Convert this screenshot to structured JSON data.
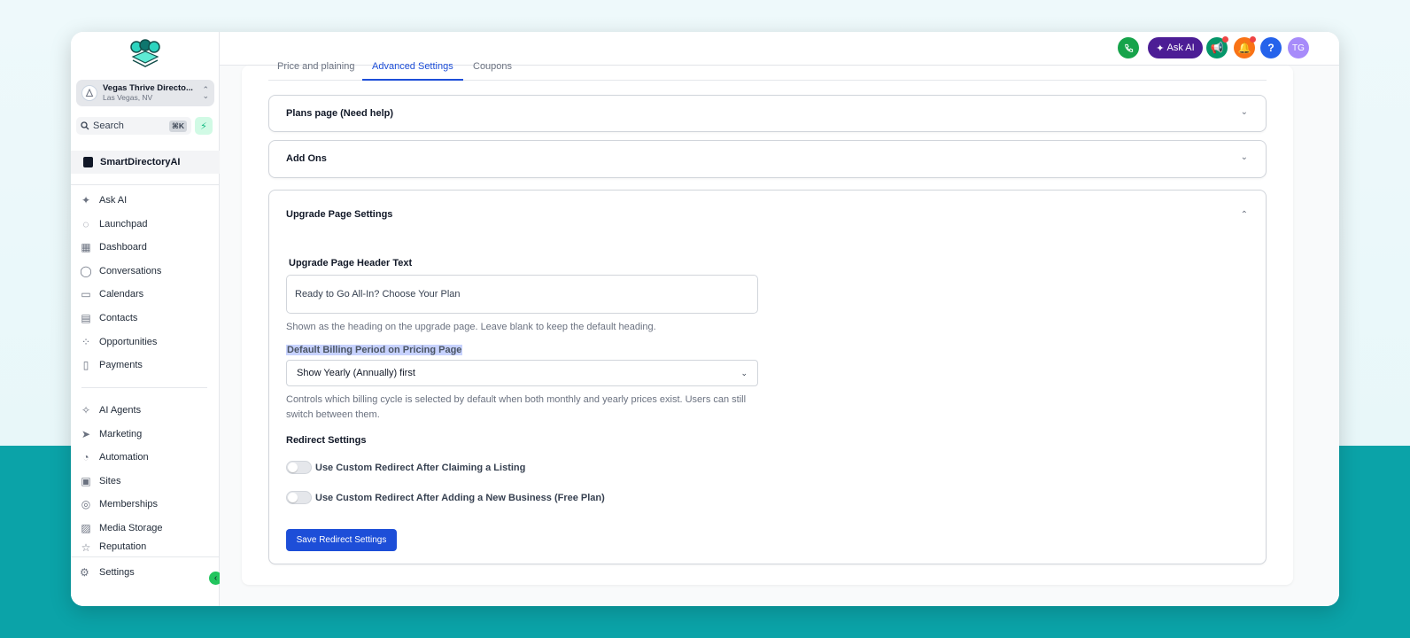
{
  "sidebar": {
    "account": {
      "name": "Vegas Thrive Directo...",
      "location": "Las Vegas, NV"
    },
    "search": {
      "label": "Search",
      "shortcut": "⌘K"
    },
    "app_name": "SmartDirectoryAI",
    "items_top": [
      {
        "label": "Ask AI",
        "icon": "sparkles-icon"
      },
      {
        "label": "Launchpad",
        "icon": "rocket-icon"
      },
      {
        "label": "Dashboard",
        "icon": "dashboard-icon"
      },
      {
        "label": "Conversations",
        "icon": "chat-icon"
      },
      {
        "label": "Calendars",
        "icon": "calendar-icon"
      },
      {
        "label": "Contacts",
        "icon": "contacts-icon"
      },
      {
        "label": "Opportunities",
        "icon": "opportunities-icon"
      },
      {
        "label": "Payments",
        "icon": "payments-icon"
      }
    ],
    "items_bottom": [
      {
        "label": "AI Agents",
        "icon": "ai-agents-icon"
      },
      {
        "label": "Marketing",
        "icon": "send-icon"
      },
      {
        "label": "Automation",
        "icon": "automation-icon"
      },
      {
        "label": "Sites",
        "icon": "sites-icon"
      },
      {
        "label": "Memberships",
        "icon": "award-icon"
      },
      {
        "label": "Media Storage",
        "icon": "image-icon"
      },
      {
        "label": "Reputation",
        "icon": "star-icon"
      }
    ],
    "settings_label": "Settings"
  },
  "topbar": {
    "ask_ai_label": "Ask AI",
    "help_label": "?",
    "user_initials": "TG",
    "colors": {
      "phone": "#16a34a",
      "ask_ai": "#4c1d95",
      "announce": "#059669",
      "bell": "#f97316",
      "help": "#2563eb",
      "avatar": "#a78bfa"
    }
  },
  "tabs": [
    {
      "label": "Price and plaining"
    },
    {
      "label": "Advanced Settings"
    },
    {
      "label": "Coupons"
    }
  ],
  "panels": {
    "plans_page": "Plans page (Need help)",
    "add_ons": "Add Ons",
    "upgrade": "Upgrade Page Settings"
  },
  "upgrade": {
    "header_label": "Upgrade Page Header Text",
    "header_value": "Ready to Go All-In? Choose Your Plan",
    "header_help": "Shown as the heading on the upgrade page. Leave blank to keep the default heading.",
    "billing_label": "Default Billing Period on Pricing Page",
    "billing_value": "Show Yearly (Annually) first",
    "billing_help": "Controls which billing cycle is selected by default when both monthly and yearly prices exist. Users can still switch between them.",
    "redirect_title": "Redirect Settings",
    "toggle_claim": "Use Custom Redirect After Claiming a Listing",
    "toggle_new_business": "Use Custom Redirect After Adding a New Business (Free Plan)",
    "save_label": "Save Redirect Settings"
  }
}
